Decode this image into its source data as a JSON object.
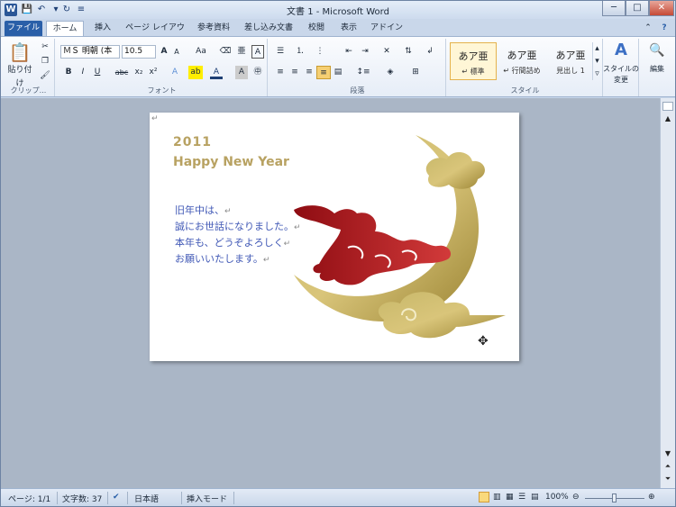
{
  "window": {
    "title": "文書 1 - Microsoft Word",
    "app_icon": "W"
  },
  "tabs": [
    {
      "label": "ファイル"
    },
    {
      "label": "ホーム"
    },
    {
      "label": "挿入"
    },
    {
      "label": "ページ レイアウト"
    },
    {
      "label": "参考資料"
    },
    {
      "label": "差し込み文書"
    },
    {
      "label": "校閲"
    },
    {
      "label": "表示"
    },
    {
      "label": "アドイン"
    }
  ],
  "ribbon": {
    "clipboard": {
      "paste_label": "貼り付け",
      "group_label": "クリップ..."
    },
    "font": {
      "font_name": "ＭＳ 明朝 (本",
      "font_size": "10.5",
      "group_label": "フォント",
      "change_case": "Aa",
      "bold": "B",
      "italic": "I",
      "underline": "U",
      "strike": "abc"
    },
    "paragraph": {
      "group_label": "段落"
    },
    "styles": {
      "group_label": "スタイル",
      "items": [
        {
          "preview": "あア亜",
          "name": "↵ 標準"
        },
        {
          "preview": "あア亜",
          "name": "↵ 行間詰め"
        },
        {
          "preview": "あア亜",
          "name": "見出し 1"
        }
      ],
      "change_styles_line1": "スタイルの",
      "change_styles_line2": "変更"
    },
    "editing": {
      "label": "編集"
    }
  },
  "document": {
    "line1": "2011",
    "line2": "Happy New Year",
    "greeting": [
      "旧年中は、",
      "誠にお世話になりました。",
      "本年も、どうぞよろしく",
      "お願いいたします。"
    ],
    "pilcrow": "↵"
  },
  "status": {
    "page": "ページ: 1/1",
    "words": "文字数: 37",
    "language": "日本語",
    "mode": "挿入モード",
    "zoom": "100%"
  },
  "colors": {
    "accent": "#2a5fa8",
    "gold": "#b8a262",
    "greeting_text": "#3f57b5",
    "rabbit": "#b0161d"
  }
}
